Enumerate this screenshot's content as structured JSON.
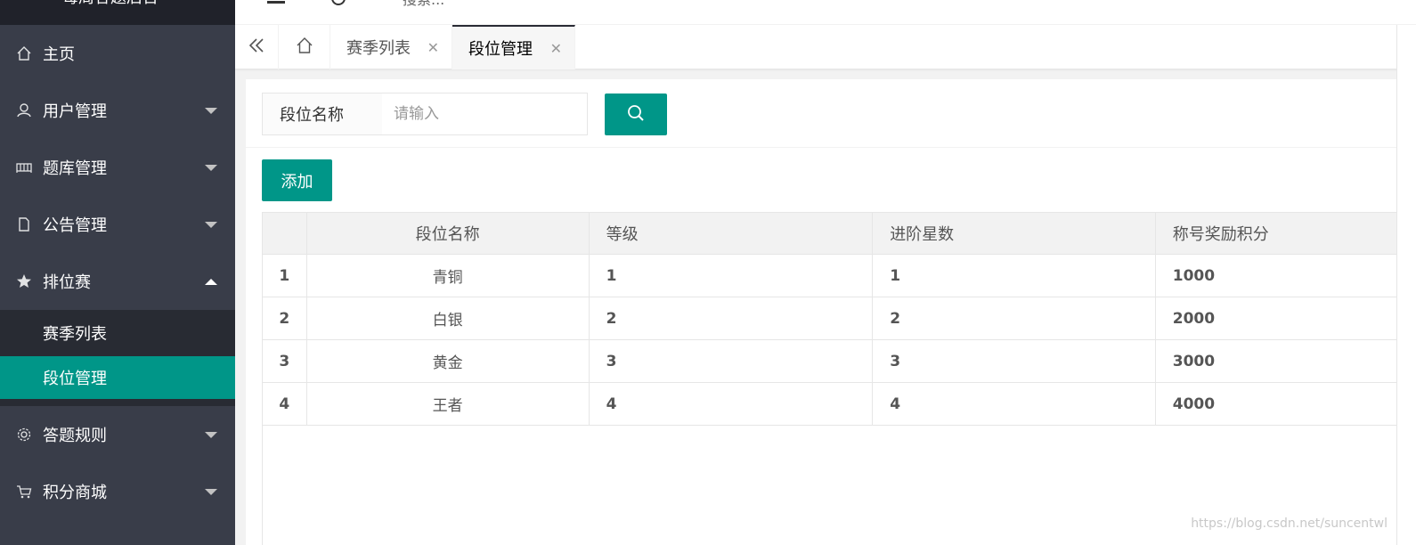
{
  "app": {
    "title": "每周答题后台"
  },
  "header": {
    "search_placeholder": "搜索..."
  },
  "sidebar": {
    "items": [
      {
        "label": "主页",
        "icon": "home-icon"
      },
      {
        "label": "用户管理",
        "icon": "user-icon"
      },
      {
        "label": "题库管理",
        "icon": "bank-icon"
      },
      {
        "label": "公告管理",
        "icon": "document-icon"
      },
      {
        "label": "排位赛",
        "icon": "star-icon"
      },
      {
        "label": "答题规则",
        "icon": "gear-icon"
      },
      {
        "label": "积分商城",
        "icon": "cart-icon"
      }
    ],
    "sub_items": [
      {
        "label": "赛季列表"
      },
      {
        "label": "段位管理"
      }
    ]
  },
  "tabs": [
    {
      "label": "赛季列表"
    },
    {
      "label": "段位管理"
    }
  ],
  "filter": {
    "field_label": "段位名称",
    "input_placeholder": "请输入"
  },
  "toolbar": {
    "add_label": "添加"
  },
  "table": {
    "columns": [
      "段位名称",
      "等级",
      "进阶星数",
      "称号奖励积分"
    ],
    "rows": [
      {
        "index": "1",
        "name": "青铜",
        "level": "1",
        "stars": "1",
        "points": "1000"
      },
      {
        "index": "2",
        "name": "白银",
        "level": "2",
        "stars": "2",
        "points": "2000"
      },
      {
        "index": "3",
        "name": "黄金",
        "level": "3",
        "stars": "3",
        "points": "3000"
      },
      {
        "index": "4",
        "name": "王者",
        "level": "4",
        "stars": "4",
        "points": "4000"
      }
    ]
  },
  "watermark": "https://blog.csdn.net/suncentwl",
  "colors": {
    "accent": "#009688",
    "sidebar_bg": "#393d49",
    "sidebar_sub_bg": "#282b33"
  }
}
